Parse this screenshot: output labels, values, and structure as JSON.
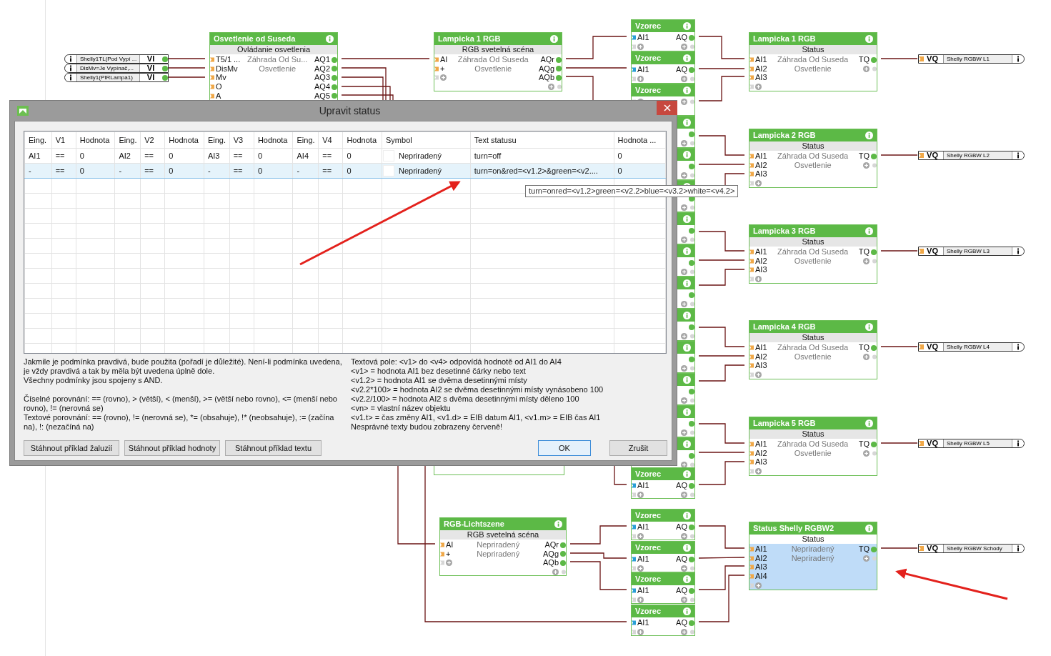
{
  "canvas": {
    "input_references": [
      {
        "label": "Shelly1TL(Pod Vypí ...",
        "type": "VI"
      },
      {
        "label": "DisMv=Je Vypínač,...",
        "type": "VI"
      },
      {
        "label": "Shelly1(PIRLampa1)",
        "type": "VI"
      }
    ],
    "blocks": [
      {
        "kind": "function",
        "title": "Osvetlenie od Suseda",
        "subtitle": "Ovládanie osvetlenia",
        "inputs": [
          "T5/1 ...",
          "DisMv",
          "Mv",
          "O",
          "A"
        ],
        "texts": [
          "Záhrada Od Su...",
          "Osvetlenie"
        ],
        "outputs": [
          "AQ1",
          "AQ2",
          "AQ3",
          "AQ4",
          "AQ5"
        ],
        "selected": false
      },
      {
        "kind": "function",
        "title": "Lampicka 1 RGB",
        "subtitle": "RGB svetelná scéna",
        "inputs": [
          "AI",
          "+"
        ],
        "texts": [
          "Záhrada Od Suseda",
          "Osvetlenie"
        ],
        "outputs": [
          "AQr",
          "AQg",
          "AQb"
        ],
        "selected": false
      },
      {
        "kind": "covered",
        "selected": false
      },
      {
        "kind": "function",
        "title": "RGB-Lichtszene",
        "subtitle": "RGB svetelná scéna",
        "inputs": [
          "AI",
          "+"
        ],
        "texts": [
          "Nepriradený",
          "Nepriradený"
        ],
        "outputs": [
          "AQr",
          "AQg",
          "AQb"
        ],
        "selected": false
      },
      {
        "kind": "formula",
        "title": "Vzorec",
        "inputs": [
          "AI1"
        ],
        "outputs": [
          "AQ"
        ],
        "selected": false
      },
      {
        "kind": "formula",
        "title": "Vzorec",
        "inputs": [
          "AI1"
        ],
        "outputs": [
          "AQ"
        ],
        "selected": false
      },
      {
        "kind": "formula",
        "title": "Vzorec",
        "selected": false
      },
      {
        "kind": "covered",
        "selected": false
      },
      {
        "kind": "covered",
        "selected": false
      },
      {
        "kind": "covered",
        "selected": false
      },
      {
        "kind": "covered",
        "selected": false
      },
      {
        "kind": "covered",
        "selected": false
      },
      {
        "kind": "covered",
        "selected": false
      },
      {
        "kind": "covered",
        "selected": false
      },
      {
        "kind": "covered",
        "selected": false
      },
      {
        "kind": "covered",
        "selected": false
      },
      {
        "kind": "covered",
        "selected": false
      },
      {
        "kind": "covered",
        "selected": false
      },
      {
        "kind": "formula",
        "title": "Vzorec",
        "inputs": [
          "AI1"
        ],
        "outputs": [
          "AQ"
        ],
        "selected": false
      },
      {
        "kind": "formula",
        "title": "Vzorec",
        "inputs": [
          "AI1"
        ],
        "outputs": [
          "AQ"
        ],
        "selected": false
      },
      {
        "kind": "formula",
        "title": "Vzorec",
        "inputs": [
          "AI1"
        ],
        "outputs": [
          "AQ"
        ],
        "selected": false
      },
      {
        "kind": "formula",
        "title": "Vzorec",
        "inputs": [
          "AI1"
        ],
        "outputs": [
          "AQ"
        ],
        "selected": false
      },
      {
        "kind": "formula",
        "title": "Vzorec",
        "inputs": [
          "AI1"
        ],
        "outputs": [
          "AQ"
        ],
        "selected": false
      },
      {
        "kind": "function",
        "title": "Lampicka 1 RGB",
        "subtitle": "Status",
        "inputs": [
          "AI1",
          "AI2",
          "AI3"
        ],
        "texts": [
          "Záhrada Od Suseda",
          "Osvetlenie"
        ],
        "outputs": [
          "TQ"
        ],
        "selected": false
      },
      {
        "kind": "function",
        "title": "Lampicka 2 RGB",
        "subtitle": "Status",
        "inputs": [
          "AI1",
          "AI2",
          "AI3"
        ],
        "texts": [
          "Záhrada Od Suseda",
          "Osvetlenie"
        ],
        "outputs": [
          "TQ"
        ],
        "selected": false
      },
      {
        "kind": "function",
        "title": "Lampicka 3 RGB",
        "subtitle": "Status",
        "inputs": [
          "AI1",
          "AI2",
          "AI3"
        ],
        "texts": [
          "Záhrada Od Suseda",
          "Osvetlenie"
        ],
        "outputs": [
          "TQ"
        ],
        "selected": false
      },
      {
        "kind": "function",
        "title": "Lampicka 4 RGB",
        "subtitle": "Status",
        "inputs": [
          "AI1",
          "AI2",
          "AI3"
        ],
        "texts": [
          "Záhrada Od Suseda",
          "Osvetlenie"
        ],
        "outputs": [
          "TQ"
        ],
        "selected": false
      },
      {
        "kind": "function",
        "title": "Lampicka 5 RGB",
        "subtitle": "Status",
        "inputs": [
          "AI1",
          "AI2",
          "AI3"
        ],
        "texts": [
          "Záhrada Od Suseda",
          "Osvetlenie"
        ],
        "outputs": [
          "TQ"
        ],
        "selected": false
      },
      {
        "kind": "function",
        "title": "Status Shelly RGBW2",
        "subtitle": "Status",
        "inputs": [
          "AI1",
          "AI2",
          "AI3",
          "AI4"
        ],
        "texts": [
          "Nepriradený",
          "Nepriradený"
        ],
        "outputs": [
          "TQ"
        ],
        "selected": true
      }
    ],
    "output_references": [
      {
        "type": "VQ",
        "label": "Shelly RGBW L1"
      },
      {
        "type": "VQ",
        "label": "Shelly RGBW L2"
      },
      {
        "type": "VQ",
        "label": "Shelly RGBW L3"
      },
      {
        "type": "VQ",
        "label": "Shelly RGBW L4"
      },
      {
        "type": "VQ",
        "label": "Shelly RGBW L5"
      },
      {
        "type": "VQ",
        "label": "Shelly RGBW Schody"
      }
    ]
  },
  "dialog": {
    "title": "Upravit status",
    "columns": [
      "Eing.",
      "V1",
      "Hodnota",
      "Eing.",
      "V2",
      "Hodnota",
      "Eing.",
      "V3",
      "Hodnota",
      "Eing.",
      "V4",
      "Hodnota",
      "Symbol",
      "Text statusu",
      "Hodnota ..."
    ],
    "rows": [
      {
        "cells": [
          "AI1",
          "==",
          "0",
          "AI2",
          "==",
          "0",
          "AI3",
          "==",
          "0",
          "AI4",
          "==",
          "0",
          "Nepriradený",
          "turn=off",
          "0"
        ],
        "selected": false
      },
      {
        "cells": [
          "-",
          "==",
          "0",
          "-",
          "==",
          "0",
          "-",
          "==",
          "0",
          "-",
          "==",
          "0",
          "Nepriradený",
          "turn=on&red=<v1.2>&green=<v2....",
          "0"
        ],
        "selected": true
      }
    ],
    "tooltip": "turn=onred=<v1.2>green=<v2.2>blue=<v3.2>white=<v4.2>",
    "help_left": [
      "Jakmile je podmínka pravdivá, bude použita (pořadí je důležité). Není-li podmínka uvedena, je vždy pravdivá a tak by měla být uvedena úplně dole.",
      "Všechny podmínky jsou spojeny s AND.",
      "Číselné porovnání: == (rovno), > (větší), < (menší), >= (větší nebo rovno), <= (menší nebo rovno), != (nerovná se)",
      "Textové porovnání: == (rovno), != (nerovná se), *= (obsahuje), !* (neobsahuje), := (začína na), !: (nezačíná na)"
    ],
    "help_right": [
      "Textová pole: <v1> do <v4> odpovídá hodnotě od AI1 do AI4",
      "<v1> = hodnota AI1 bez desetinné čárky nebo text",
      "<v1.2> = hodnota AI1 se dvěma desetinnými místy",
      "<v2.2*100> = hodnota AI2 se dvěma desetinnými místy vynásobeno 100",
      "<v2.2/100> = hodnota AI2 s dvěma desetinnými místy děleno 100",
      "<vn> = vlastní název objektu",
      "<v1.t> = čas změny AI1, <v1.d> = EIB datum AI1, <v1.m> = EIB čas AI1",
      "Nesprávné texty budou zobrazeny červeně!"
    ],
    "buttons": [
      {
        "label": "Stáhnout příklad žaluzií",
        "default": false
      },
      {
        "label": "Stáhnout příklad hodnoty",
        "default": false
      },
      {
        "label": "Stáhnout příklad textu",
        "default": false
      },
      {
        "label": "OK",
        "default": true
      },
      {
        "label": "Zrušit",
        "default": false
      }
    ]
  }
}
